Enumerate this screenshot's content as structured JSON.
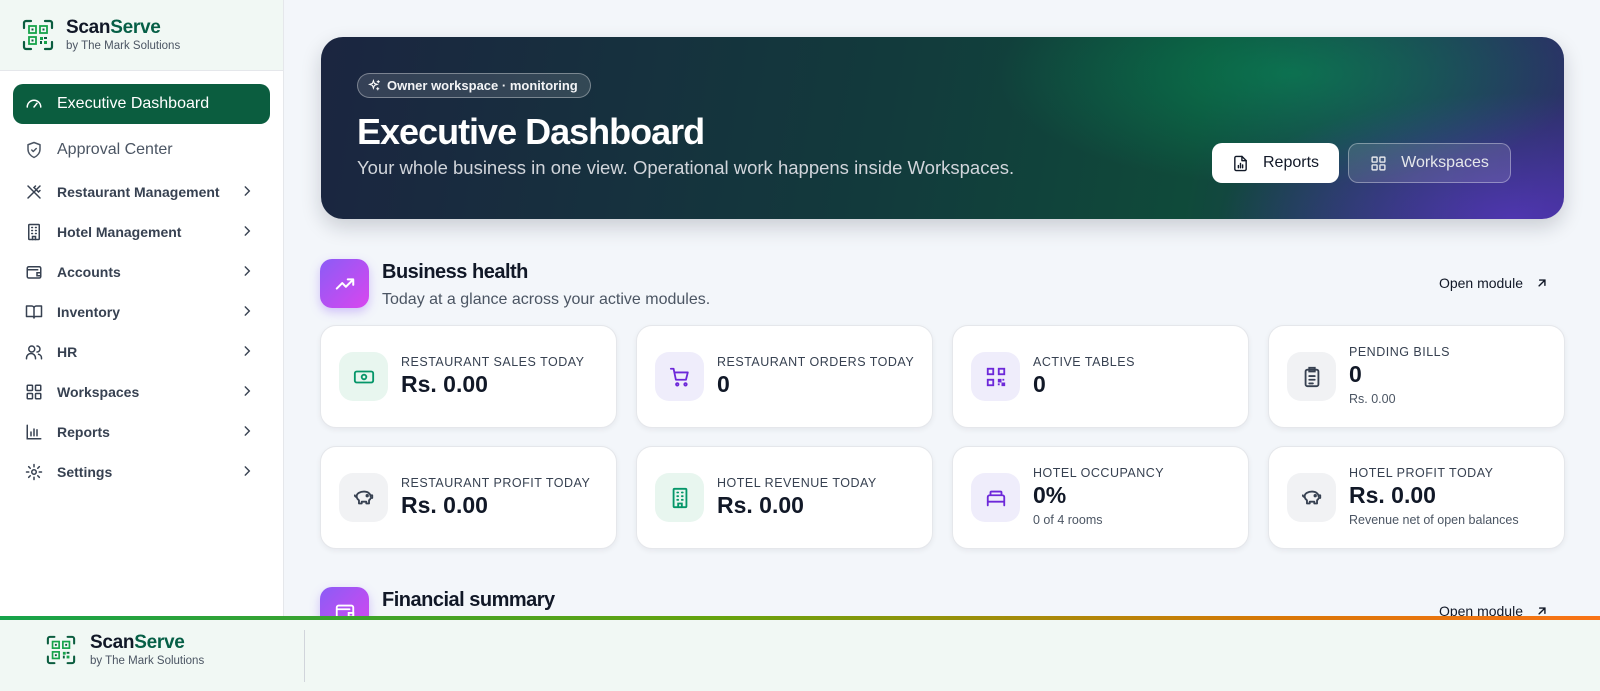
{
  "app": {
    "brand_part1": "Scan",
    "brand_part2": "Serve",
    "brand_sub": "by The Mark Solutions"
  },
  "sidebar": {
    "items": [
      {
        "label": "Executive Dashboard",
        "icon": "gauge-icon",
        "active": true
      },
      {
        "label": "Approval Center",
        "icon": "shield-check-icon"
      },
      {
        "label": "Restaurant Management",
        "icon": "utensils-icon"
      },
      {
        "label": "Hotel Management",
        "icon": "building-icon"
      },
      {
        "label": "Accounts",
        "icon": "wallet-icon"
      },
      {
        "label": "Inventory",
        "icon": "book-icon"
      },
      {
        "label": "HR",
        "icon": "users-icon"
      },
      {
        "label": "Workspaces",
        "icon": "grid-icon"
      },
      {
        "label": "Reports",
        "icon": "bar-chart-icon"
      },
      {
        "label": "Settings",
        "icon": "gear-icon"
      }
    ]
  },
  "hero": {
    "chip": "Owner workspace · monitoring",
    "title": "Executive Dashboard",
    "subtitle": "Your whole business in one view. Operational work happens inside Workspaces.",
    "reports_button": "Reports",
    "workspaces_button": "Workspaces"
  },
  "business_health": {
    "title": "Business health",
    "subtitle": "Today at a glance across your active modules.",
    "open_module": "Open module",
    "cards": [
      {
        "label": "RESTAURANT SALES TODAY",
        "value": "Rs. 0.00",
        "icon": "cash-icon"
      },
      {
        "label": "RESTAURANT ORDERS TODAY",
        "value": "0",
        "icon": "cart-icon"
      },
      {
        "label": "ACTIVE TABLES",
        "value": "0",
        "icon": "qr-code-icon"
      },
      {
        "label": "PENDING BILLS",
        "value": "0",
        "sub": "Rs. 0.00",
        "icon": "clipboard-icon"
      },
      {
        "label": "RESTAURANT PROFIT TODAY",
        "value": "Rs. 0.00",
        "icon": "piggy-bank-icon"
      },
      {
        "label": "HOTEL REVENUE TODAY",
        "value": "Rs. 0.00",
        "icon": "building-icon"
      },
      {
        "label": "HOTEL OCCUPANCY",
        "value": "0%",
        "sub": "0 of 4 rooms",
        "icon": "bed-icon"
      },
      {
        "label": "HOTEL PROFIT TODAY",
        "value": "Rs. 0.00",
        "sub": "Revenue net of open balances",
        "icon": "piggy-bank-icon"
      }
    ]
  },
  "financial_summary": {
    "title": "Financial summary",
    "open_module": "Open module"
  },
  "colors": {
    "primary": "#0b5d3f",
    "accent_violet": "#8b5cf6",
    "hero_dark": "#1b2540"
  }
}
